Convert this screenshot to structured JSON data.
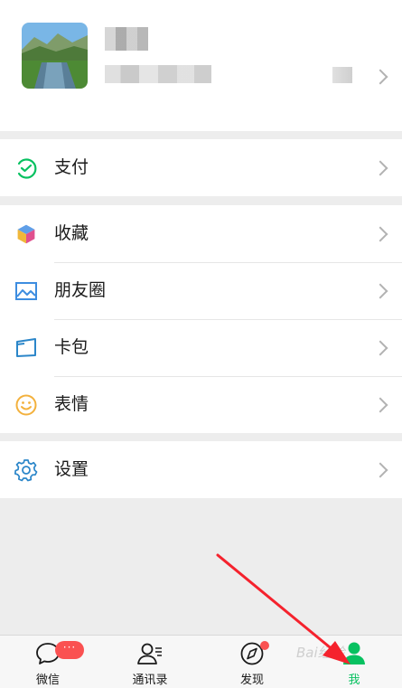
{
  "colors": {
    "accent": "#07c160",
    "badge": "#fa5151",
    "arrow": "#f5222d"
  },
  "menu": {
    "pay": {
      "label": "支付",
      "icon": "wallet-icon"
    },
    "favorites": {
      "label": "收藏",
      "icon": "cube-icon"
    },
    "moments": {
      "label": "朋友圈",
      "icon": "picture-icon"
    },
    "cards": {
      "label": "卡包",
      "icon": "card-icon"
    },
    "stickers": {
      "label": "表情",
      "icon": "smiley-icon"
    },
    "settings": {
      "label": "设置",
      "icon": "gear-icon"
    }
  },
  "tabbar": {
    "chats": {
      "label": "微信",
      "badge": "···"
    },
    "contacts": {
      "label": "通讯录"
    },
    "discover": {
      "label": "发现"
    },
    "me": {
      "label": "我",
      "active": true
    }
  },
  "watermark": "Bai经验"
}
